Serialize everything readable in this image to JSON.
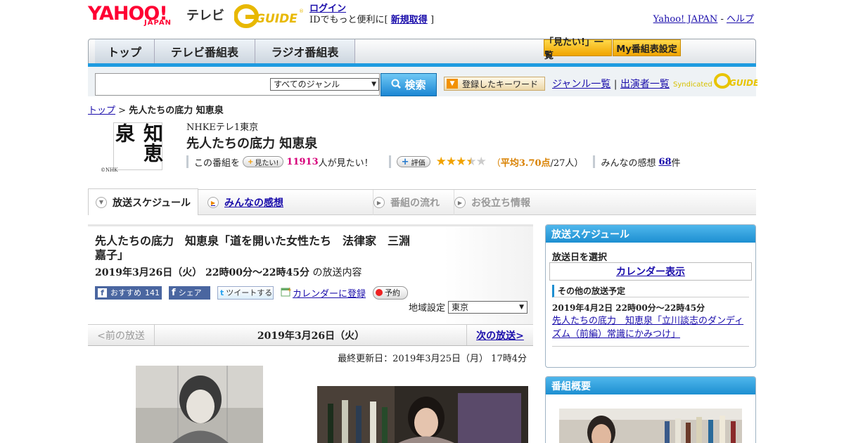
{
  "header": {
    "logo_yahoo": "YAHOO!",
    "logo_japan": "JAPAN",
    "logo_tv": "テレビ",
    "logo_gguide": "GUIDE",
    "login_label": "ログイン",
    "login_desc_prefix": "IDでもっと便利に[",
    "register_label": "新規取得",
    "login_desc_suffix": "]",
    "yahoo_japan_link": "Yahoo! JAPAN",
    "separator": "-",
    "help_link": "ヘルプ"
  },
  "tabs": [
    {
      "label": "トップ"
    },
    {
      "label": "テレビ番組表"
    },
    {
      "label": "ラジオ番組表"
    }
  ],
  "top_buttons": {
    "watchlist": "「見たい!」一覧",
    "my_schedule": "My番組表設定"
  },
  "search": {
    "genre_selected": "すべてのジャンル",
    "button_label": "検索",
    "keyword_button": "登録したキーワード",
    "genre_list_link": "ジャンル一覧",
    "divider": "|",
    "cast_list_link": "出演者一覧",
    "syndicated": "Syndicated"
  },
  "breadcrumb": {
    "top": "トップ",
    "sep": ">",
    "current": "先人たちの底力 知恵泉"
  },
  "program": {
    "channel": "NHKEテレ1東京",
    "title": "先人たちの底力 知恵泉",
    "logo_text": "知恵泉",
    "nhk_mark": "©NHK",
    "this_program": "この番組を",
    "want_button": "見たい!",
    "want_count": "11913",
    "want_suffix": "人が見たい！",
    "rating_button": "評価",
    "rating_stars": 3.5,
    "rating_open": "（",
    "rating_avg": "平均3.70点",
    "rating_count": "/27人）",
    "impressions_label": "みんなの感想",
    "impressions_count": "68",
    "impressions_suffix": "件"
  },
  "subtabs": [
    {
      "label": "放送スケジュール"
    },
    {
      "label": "みんなの感想"
    },
    {
      "label": "番組の流れ"
    },
    {
      "label": "お役立ち情報"
    }
  ],
  "episode": {
    "title": "先人たちの底力　知恵泉「道を開いた女性たち　法律家　三淵嘉子」",
    "date": "2019年3月26日（火）  22時00分～22時45分",
    "date_suffix": "の放送内容",
    "fb_recommend": "おすすめ",
    "fb_count": "141",
    "fb_share": "シェア",
    "tweet": "ツイートする",
    "calendar_register": "カレンダーに登録",
    "reserve": "予約",
    "region_label": "地域設定",
    "region_value": "東京"
  },
  "nav": {
    "prev": "<前の放送",
    "date": "2019年3月26日（火）",
    "next": "次の放送>"
  },
  "updated": "最終更新日：2019年3月25日（月）  17時4分",
  "sidebar": {
    "schedule_header": "放送スケジュール",
    "select_date": "放送日を選択",
    "calendar_link": "カレンダー表示",
    "other_broadcasts": "その他の放送予定",
    "next_date": "2019年4月2日  22時00分～22時45分",
    "next_title": "先人たちの底力　知恵泉「立川談志のダンディズム（前編）常識にかみつけ」",
    "overview_header": "番組概要"
  }
}
